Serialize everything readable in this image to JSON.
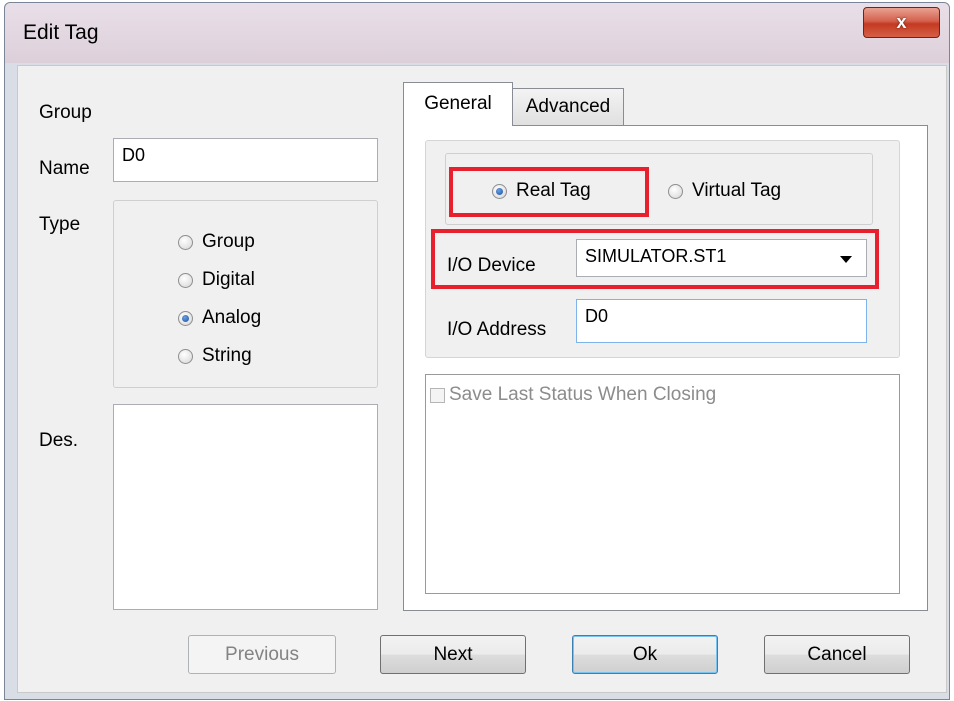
{
  "window": {
    "title": "Edit Tag",
    "close_glyph": "x"
  },
  "left": {
    "group_label": "Group",
    "name_label": "Name",
    "name_value": "D0",
    "type_label": "Type",
    "type_options": [
      "Group",
      "Digital",
      "Analog",
      "String"
    ],
    "type_selected": "Analog",
    "des_label": "Des.",
    "des_value": ""
  },
  "tabs": [
    {
      "label": "General",
      "active": true
    },
    {
      "label": "Advanced",
      "active": false
    }
  ],
  "general": {
    "tag_kind": {
      "options": [
        "Real Tag",
        "Virtual Tag"
      ],
      "selected": "Real Tag"
    },
    "io_device_label": "I/O Device",
    "io_device_value": "SIMULATOR.ST1",
    "io_address_label": "I/O Address",
    "io_address_value": "D0",
    "save_last_status_label": "Save Last Status When Closing",
    "save_last_status_checked": false,
    "save_last_status_enabled": false
  },
  "buttons": {
    "previous": "Previous",
    "next": "Next",
    "ok": "Ok",
    "cancel": "Cancel"
  },
  "colors": {
    "highlight": "#e8202d",
    "radio_selected": "#1d4f9e",
    "close_button": "#c33a22"
  },
  "icons": {
    "close": "close-icon",
    "dropdown": "chevron-down-icon",
    "radio": "radio-icon",
    "checkbox": "checkbox-icon"
  }
}
